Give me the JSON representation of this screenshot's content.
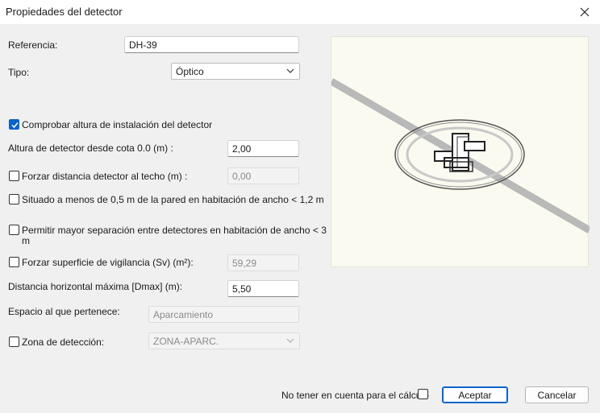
{
  "window": {
    "title": "Propiedades del detector"
  },
  "fields": {
    "referencia": {
      "label": "Referencia:",
      "value": "DH-39"
    },
    "tipo": {
      "label": "Tipo:",
      "value": "Óptico"
    },
    "comprobar_altura": {
      "label": "Comprobar altura de instalación del detector",
      "checked": true
    },
    "altura_detector": {
      "label": "Altura de detector desde cota 0.0 (m) :",
      "value": "2,00"
    },
    "forzar_distancia": {
      "label": "Forzar distancia detector al techo (m) :",
      "value": "0,00",
      "checked": false
    },
    "situado_pared": {
      "label": "Situado a menos de 0,5 m de la pared en habitación de ancho < 1,2 m",
      "checked": false
    },
    "permitir_separacion": {
      "label_line1": "Permitir mayor separación entre detectores en habitación de ancho < 3",
      "label_line2": "m",
      "checked": false
    },
    "forzar_superficie": {
      "label": "Forzar superficie de vigilancia (Sv) (m²):",
      "value": "59,29",
      "checked": false
    },
    "distancia_horizontal": {
      "label": "Distancia horizontal máxima [Dmax] (m):",
      "value": "5,50"
    },
    "espacio": {
      "label": "Espacio al que pertenece:",
      "value": "Aparcamiento"
    },
    "zona": {
      "label": "Zona de detección:",
      "value": "ZONA-APARC.",
      "checked": false
    }
  },
  "footer": {
    "no_calculo_label": "No tener en cuenta para el cálculo",
    "accept_label": "Aceptar",
    "cancel_label": "Cancelar"
  },
  "colors": {
    "accent": "#0a64c8",
    "preview_bg": "#fafaf0"
  }
}
